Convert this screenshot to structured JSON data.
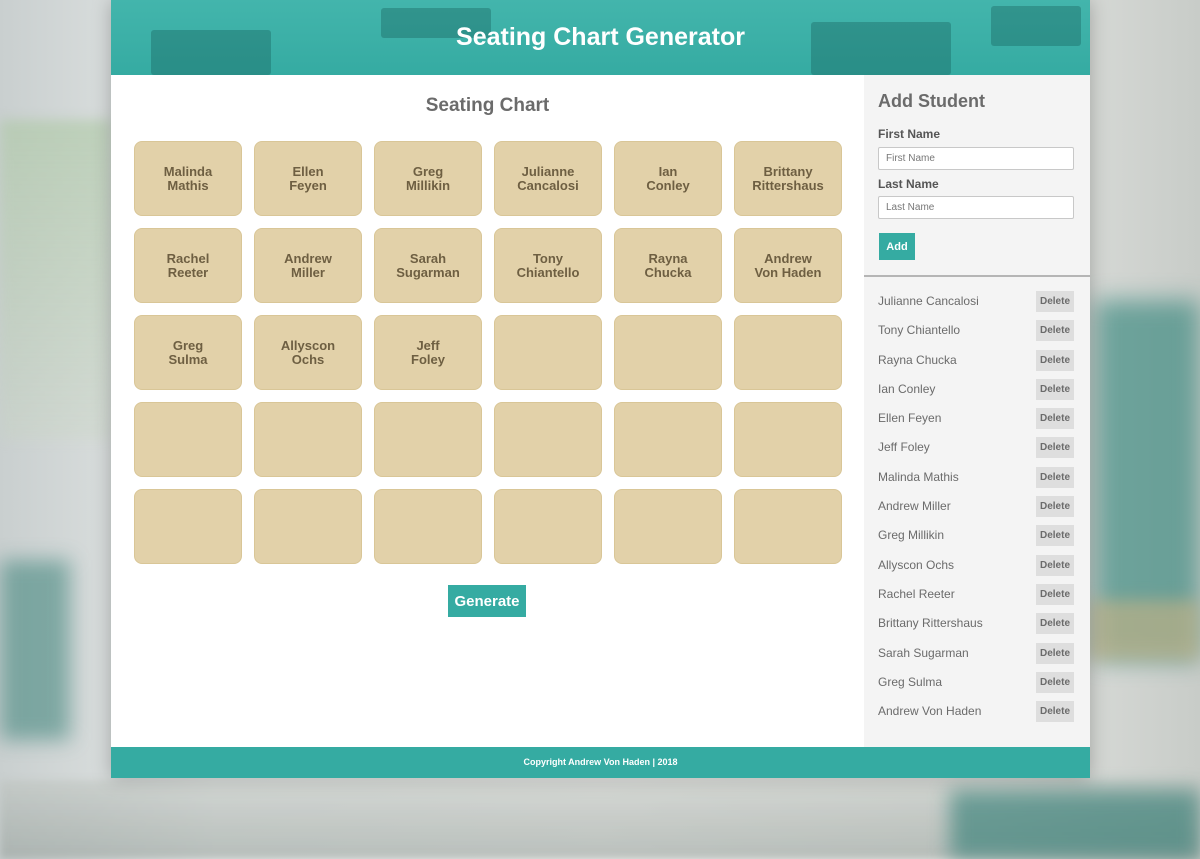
{
  "app": {
    "title": "Seating Chart Generator"
  },
  "colors": {
    "accent": "#35aba2",
    "seat": "#e2d1a9",
    "sidebar_bg": "#f4f4f4",
    "delete_bg": "#dedede"
  },
  "chart": {
    "title": "Seating Chart",
    "generate_label": "Generate",
    "seats": [
      [
        "Malinda",
        "Mathis"
      ],
      [
        "Ellen",
        "Feyen"
      ],
      [
        "Greg",
        "Millikin"
      ],
      [
        "Julianne",
        "Cancalosi"
      ],
      [
        "Ian",
        "Conley"
      ],
      [
        "Brittany",
        "Rittershaus"
      ],
      [
        "Rachel",
        "Reeter"
      ],
      [
        "Andrew",
        "Miller"
      ],
      [
        "Sarah",
        "Sugarman"
      ],
      [
        "Tony",
        "Chiantello"
      ],
      [
        "Rayna",
        "Chucka"
      ],
      [
        "Andrew",
        "Von Haden"
      ],
      [
        "Greg",
        "Sulma"
      ],
      [
        "Allyscon",
        "Ochs"
      ],
      [
        "Jeff",
        "Foley"
      ],
      [
        "",
        ""
      ],
      [
        "",
        ""
      ],
      [
        "",
        ""
      ],
      [
        "",
        ""
      ],
      [
        "",
        ""
      ],
      [
        "",
        ""
      ],
      [
        "",
        ""
      ],
      [
        "",
        ""
      ],
      [
        "",
        ""
      ],
      [
        "",
        ""
      ],
      [
        "",
        ""
      ],
      [
        "",
        ""
      ],
      [
        "",
        ""
      ],
      [
        "",
        ""
      ],
      [
        "",
        ""
      ]
    ]
  },
  "sidebar": {
    "add_title": "Add Student",
    "first_name_label": "First Name",
    "first_name_placeholder": "First Name",
    "first_name_value": "",
    "last_name_label": "Last Name",
    "last_name_placeholder": "Last Name",
    "last_name_value": "",
    "add_label": "Add",
    "delete_label": "Delete",
    "students": [
      "Julianne Cancalosi",
      "Tony Chiantello",
      "Rayna Chucka",
      "Ian Conley",
      "Ellen Feyen",
      "Jeff Foley",
      "Malinda Mathis",
      "Andrew Miller",
      "Greg Millikin",
      "Allyscon Ochs",
      "Rachel Reeter",
      "Brittany Rittershaus",
      "Sarah Sugarman",
      "Greg Sulma",
      "Andrew Von Haden"
    ]
  },
  "footer": {
    "text": "Copyright Andrew Von Haden | 2018"
  }
}
